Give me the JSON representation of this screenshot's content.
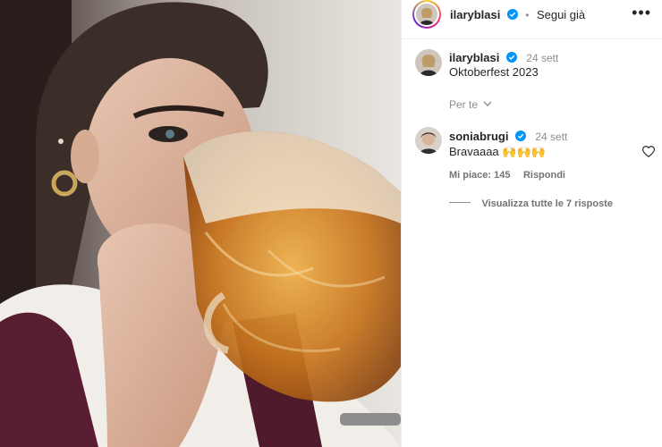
{
  "post": {
    "author": "ilaryblasi",
    "follow_state": "Segui già",
    "caption_author": "ilaryblasi",
    "caption_time": "24 sett",
    "caption_text": "Oktoberfest 2023",
    "translation_toggle": "Per te"
  },
  "comments": [
    {
      "author": "soniabrugi",
      "time": "24 sett",
      "text": "Bravaaaa 🙌🙌🙌",
      "likes_label": "Mi piace: 145",
      "reply_label": "Rispondi",
      "view_replies": "Visualizza tutte le 7 risposte"
    }
  ],
  "icons": {
    "verified": "verified-badge-icon",
    "more": "more-options-icon",
    "chevron": "chevron-down-icon",
    "like": "heart-icon"
  },
  "colors": {
    "verified": "#0095f6",
    "text": "#262626",
    "muted": "#8e8e8e"
  }
}
